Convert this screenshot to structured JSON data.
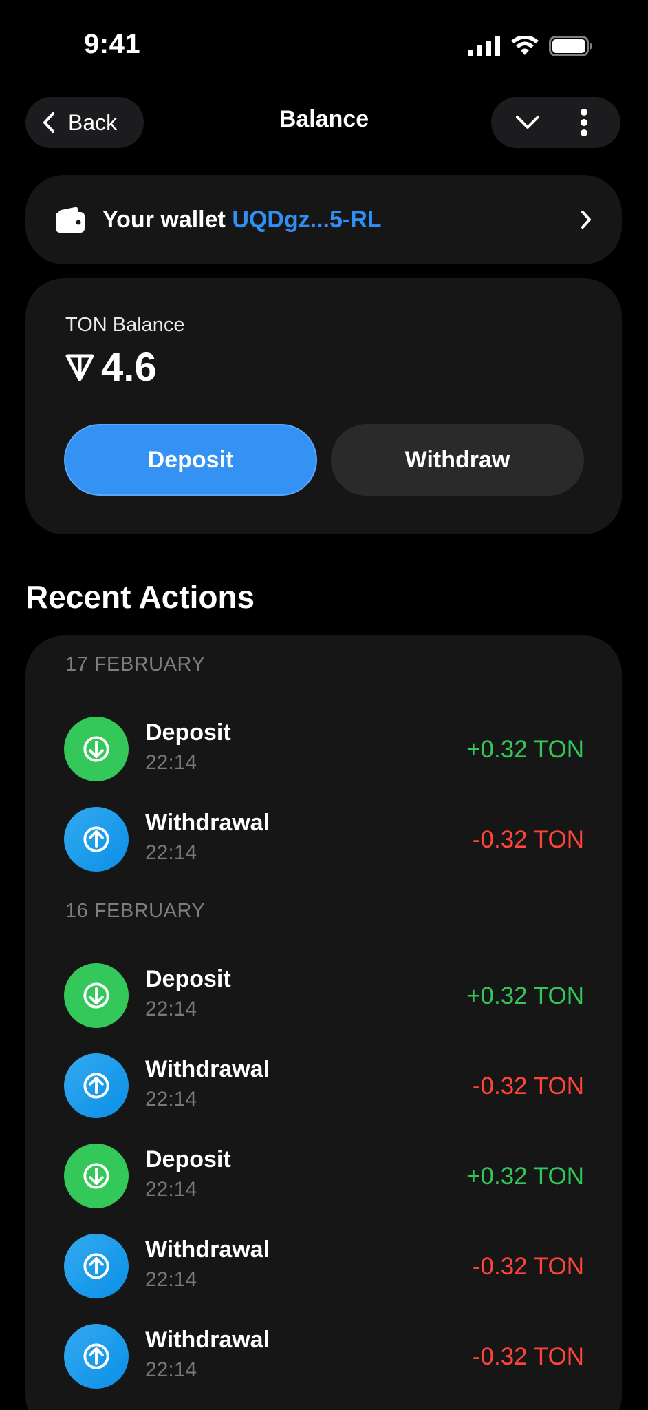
{
  "status_bar": {
    "time": "9:41"
  },
  "nav": {
    "back_label": "Back",
    "title": "Balance"
  },
  "wallet": {
    "label": "Your wallet",
    "address": "UQDgz...5-RL"
  },
  "balance": {
    "label": "TON Balance",
    "value": "4.6",
    "deposit_label": "Deposit",
    "withdraw_label": "Withdraw"
  },
  "recent": {
    "title": "Recent Actions",
    "groups": [
      {
        "date": "17 FEBRUARY",
        "items": [
          {
            "title": "Deposit",
            "time": "22:14",
            "amount": "+0.32 TON",
            "direction": "in"
          },
          {
            "title": "Withdrawal",
            "time": "22:14",
            "amount": "-0.32 TON",
            "direction": "out"
          }
        ]
      },
      {
        "date": "16 FEBRUARY",
        "items": [
          {
            "title": "Deposit",
            "time": "22:14",
            "amount": "+0.32 TON",
            "direction": "in"
          },
          {
            "title": "Withdrawal",
            "time": "22:14",
            "amount": "-0.32 TON",
            "direction": "out"
          },
          {
            "title": "Deposit",
            "time": "22:14",
            "amount": "+0.32 TON",
            "direction": "in"
          },
          {
            "title": "Withdrawal",
            "time": "22:14",
            "amount": "-0.32 TON",
            "direction": "out"
          },
          {
            "title": "Withdrawal",
            "time": "22:14",
            "amount": "-0.32 TON",
            "direction": "out"
          }
        ]
      }
    ]
  },
  "colors": {
    "accent": "#3592f5",
    "positive": "#33c759",
    "negative": "#ff453a",
    "card": "#161616"
  },
  "icons": {
    "deposit": "arrow-down-circle-icon",
    "withdraw": "arrow-up-circle-icon",
    "wallet": "wallet-icon",
    "ton": "ton-logo-icon"
  }
}
